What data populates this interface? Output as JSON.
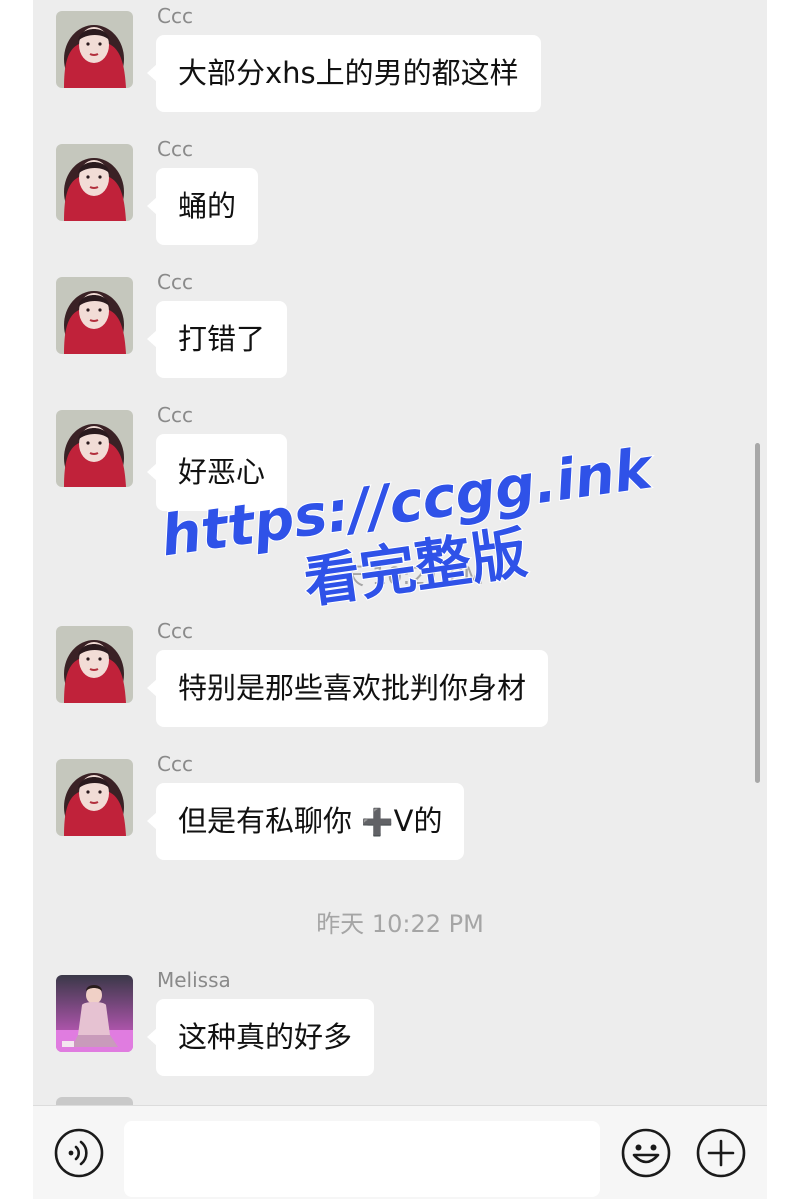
{
  "messages": [
    {
      "sender": "Ccc",
      "text": "大部分xhs上的男的都这样",
      "avatar": "ccc"
    },
    {
      "sender": "Ccc",
      "text": "蛹的",
      "avatar": "ccc"
    },
    {
      "sender": "Ccc",
      "text": "打错了",
      "avatar": "ccc"
    },
    {
      "sender": "Ccc",
      "text": "好恶心",
      "avatar": "ccc"
    },
    {
      "sender": "Ccc",
      "text": "特别是那些喜欢批判你身材",
      "avatar": "ccc"
    },
    {
      "sender": "Ccc",
      "text_before": "但是有私聊你",
      "plus": "➕",
      "text_after": "V的",
      "avatar": "ccc"
    },
    {
      "sender": "Melissa",
      "text": "这种真的好多",
      "avatar": "melissa"
    }
  ],
  "timestamps": {
    "obscured": "昨天 10:21 PM",
    "second": "昨天 10:22 PM"
  },
  "watermark": {
    "line1": "https://ccgg.ink",
    "line2": "看完整版"
  },
  "input_bar": {
    "voice_icon": "voice-icon",
    "emoji_icon": "emoji-icon",
    "plus_icon": "plus-icon",
    "placeholder": ""
  },
  "colors": {
    "chat_background": "#ededed",
    "bubble": "#ffffff",
    "watermark": "#2f52e8",
    "timestamp": "#a5a5a5"
  }
}
